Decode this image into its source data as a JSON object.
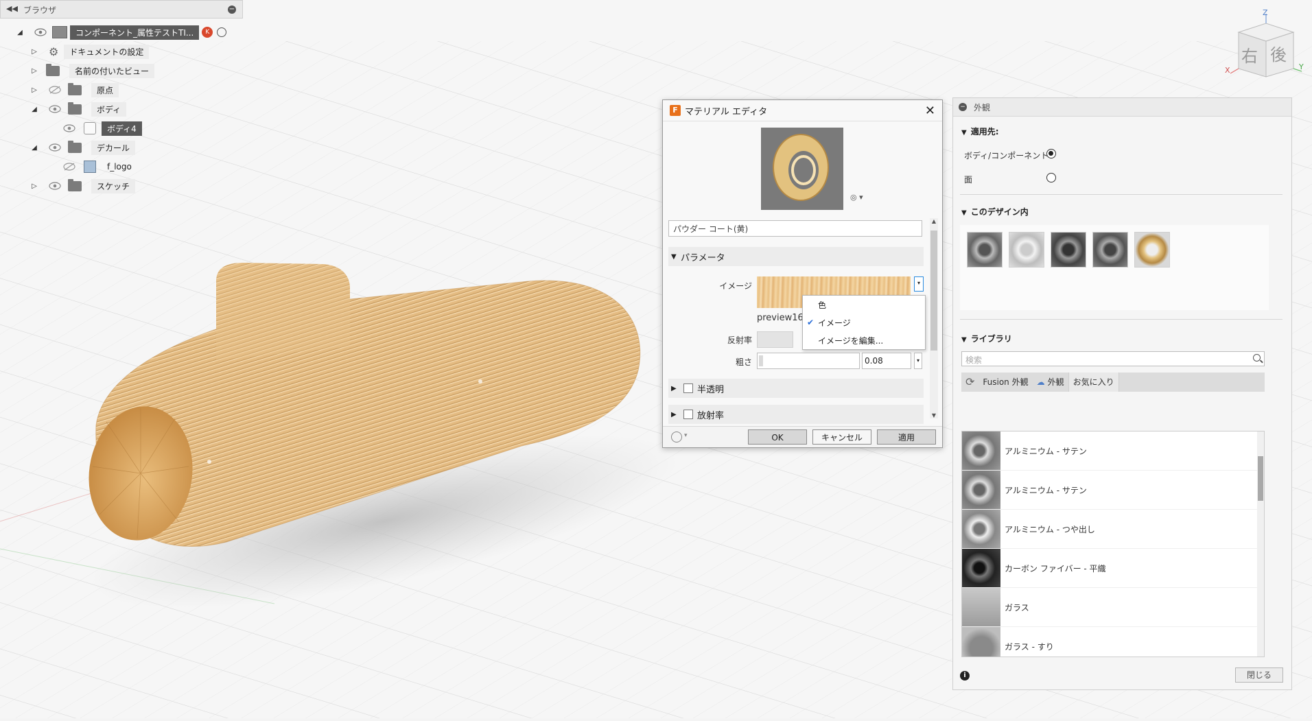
{
  "browser": {
    "title": "ブラウザ",
    "collapse_icon": "double-left-arrow-icon",
    "items": [
      {
        "label": "コンポーネント_属性テストTI..."
      },
      {
        "label": "ドキュメントの設定"
      },
      {
        "label": "名前の付いたビュー"
      },
      {
        "label": "原点"
      },
      {
        "label": "ボディ"
      },
      {
        "label": "ボディ4"
      },
      {
        "label": "デカール"
      },
      {
        "label": "f_logo"
      },
      {
        "label": "スケッチ"
      }
    ]
  },
  "material_editor": {
    "title": "マテリアル エディタ",
    "material_name": "パウダー コート(黄)",
    "sections": {
      "parameters": "パラメータ",
      "translucency": "半透明",
      "emissive": "放射率"
    },
    "labels": {
      "image": "イメージ",
      "reflectance": "反射率",
      "roughness": "粗さ"
    },
    "image_filename": "preview16.",
    "roughness_value": "0.08",
    "dropdown": {
      "options": [
        "色",
        "イメージ",
        "イメージを編集..."
      ],
      "checked": "イメージ"
    },
    "buttons": {
      "ok": "OK",
      "cancel": "キャンセル",
      "apply": "適用"
    }
  },
  "appearance": {
    "title": "外観",
    "apply_to": {
      "header": "適用先:",
      "option_body": "ボディ/コンポーネント",
      "option_face": "面",
      "selected": "ボディ/コンポーネント"
    },
    "in_design": {
      "header": "このデザイン内"
    },
    "library": {
      "header": "ライブラリ",
      "search_placeholder": "検索",
      "tabs": [
        "Fusion 外観",
        "外観",
        "お気に入り"
      ],
      "items": [
        {
          "name": "アルミニウム - サテン"
        },
        {
          "name": "アルミニウム - サテン"
        },
        {
          "name": "アルミニウム - つや出し"
        },
        {
          "name": "カーボン ファイバー - 平織"
        },
        {
          "name": "ガラス"
        },
        {
          "name": "ガラス - すり"
        }
      ]
    },
    "close_label": "閉じる"
  },
  "viewcube": {
    "front": "右",
    "side": "後",
    "axes": {
      "z": "Z",
      "x": "X",
      "y": "Y"
    }
  },
  "colors": {
    "accent": "#2a8be0",
    "fusion_orange": "#e8701a",
    "wood": "#e6c08a"
  }
}
